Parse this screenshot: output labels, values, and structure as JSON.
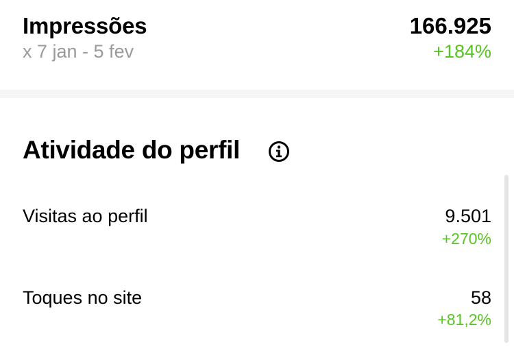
{
  "impressions": {
    "title": "Impressões",
    "date_range": "x 7 jan - 5 fev",
    "value": "166.925",
    "change": "+184%"
  },
  "profile_activity": {
    "title": "Atividade do perfil",
    "info_icon": "info-circle-icon",
    "metrics": [
      {
        "label": "Visitas ao perfil",
        "value": "9.501",
        "change": "+270%"
      },
      {
        "label": "Toques no site",
        "value": "58",
        "change": "+81,2%"
      }
    ]
  },
  "colors": {
    "positive_change": "#58c322",
    "secondary_text": "#9a9a9a",
    "divider": "#f6f6f6"
  }
}
